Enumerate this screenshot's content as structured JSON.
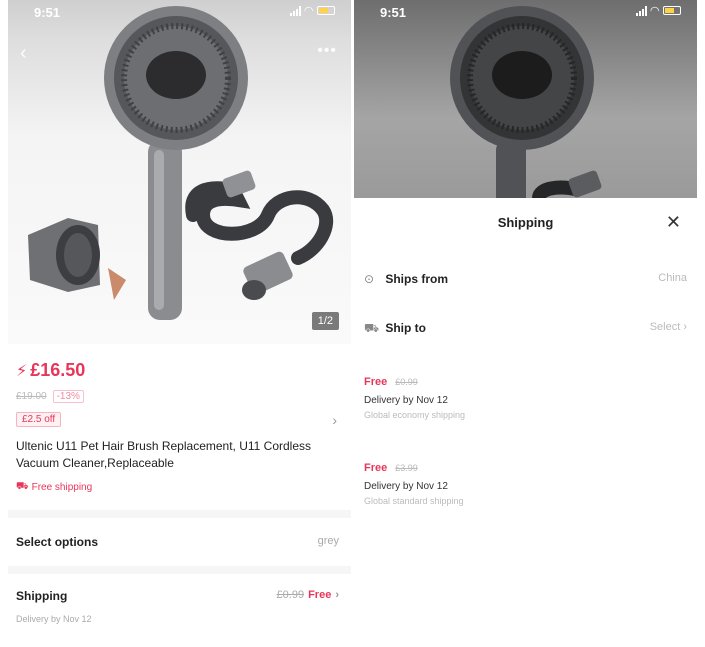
{
  "left": {
    "status": {
      "time": "9:51"
    },
    "image_counter": "1/2",
    "price": "£16.50",
    "original_price": "£19.00",
    "discount": "-13%",
    "coupon": "£2.5 off",
    "title": "Ultenic U11 Pet Hair Brush Replacement, U11 Cordless Vacuum Cleaner,Replaceable",
    "free_shipping": "Free shipping",
    "select_options": {
      "label": "Select options",
      "value": "grey"
    },
    "shipping": {
      "label": "Shipping",
      "strike": "£0.99",
      "value": "Free",
      "delivery": "Delivery by Nov 12"
    }
  },
  "right": {
    "status": {
      "time": "9:51"
    },
    "sheet_title": "Shipping",
    "ships_from": {
      "label": "Ships from",
      "value": "China"
    },
    "ship_to": {
      "label": "Ship to",
      "value": "Select"
    },
    "options": [
      {
        "price": "Free",
        "strike": "£0.99",
        "delivery": "Delivery by Nov 12",
        "method": "Global economy shipping"
      },
      {
        "price": "Free",
        "strike": "£3.99",
        "delivery": "Delivery by Nov 12",
        "method": "Global standard shipping"
      }
    ]
  },
  "colors": {
    "accent": "#e8365a",
    "muted": "#aaaaaa"
  }
}
